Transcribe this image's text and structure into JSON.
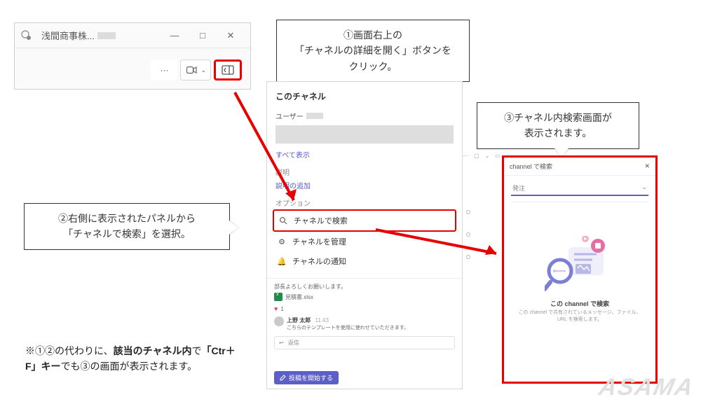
{
  "callouts": {
    "one": {
      "line1": "①画面右上の",
      "line2": "「チャネルの詳細を開く」ボタンを",
      "line3": "クリック。"
    },
    "two": {
      "line1": "②右側に表示されたパネルから",
      "line2": "「チャネルで検索」を選択。"
    },
    "three": {
      "line1": "③チャネル内検索画面が",
      "line2": "表示されます。"
    }
  },
  "teams_window": {
    "title_prefix": "浅間商事株...",
    "btn_min": "—",
    "btn_max": "□",
    "btn_close": "✕",
    "more": "···",
    "chevron": "⌄"
  },
  "channel_panel": {
    "heading": "このチャネル",
    "user_label": "ユーザー",
    "show_all": "すべて表示",
    "desc_label": "説明",
    "add_desc": "説明の追加",
    "options_label": "オプション",
    "opt_search": "チャネルで検索",
    "opt_manage": "チャネルを管理",
    "opt_notify": "チャネルの通知"
  },
  "feed": {
    "line1": "部長よろしくお願いします。",
    "filename": "見積書.xlsx",
    "like_count": "1",
    "author": "上野 太郎",
    "time": "11:43",
    "body": "こちらのテンプレートを使用に使わせていただきます。",
    "reply": "返信",
    "new_post": "投稿を開始する"
  },
  "search_panel": {
    "header": "channel で検索",
    "close": "✕",
    "input_placeholder": "発注",
    "dropdown": "⌄",
    "caption": "この channel で検索",
    "sub": "この channel で共有されているメッセージ、ファイル、URL を検索します。"
  },
  "note": {
    "prefix": "※①②の代わりに、",
    "bold1": "該当のチャネル内",
    "mid": "で",
    "bold2": "「Ctr＋F」キー",
    "suffix": "でも③の画面が表示されます。"
  },
  "watermark": "ASAMA"
}
